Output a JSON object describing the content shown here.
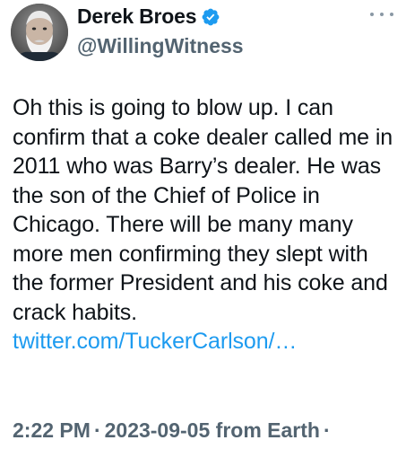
{
  "header": {
    "display_name": "Derek Broes",
    "handle": "@WillingWitness",
    "avatar_label": "avatar",
    "verified_icon": "verified-badge-icon",
    "more_icon": "more-options-icon"
  },
  "tweet": {
    "text": "Oh this is going to blow up.  I can confirm that a coke dealer called me in 2011 who was Barry’s dealer. He was the son of the Chief of Police in Chicago.  There will be many many more men confirming they slept with the former President and his coke and crack habits. ",
    "link_text": "twitter.com/TuckerCarlson/…",
    "link_color": "#1d9bf0"
  },
  "meta": {
    "time": "2:22 PM",
    "date": "2023-09-05",
    "source": "from Earth",
    "separator": "·"
  },
  "colors": {
    "text": "#0f1419",
    "secondary": "#536471",
    "verified_badge": "#1d9bf0"
  }
}
